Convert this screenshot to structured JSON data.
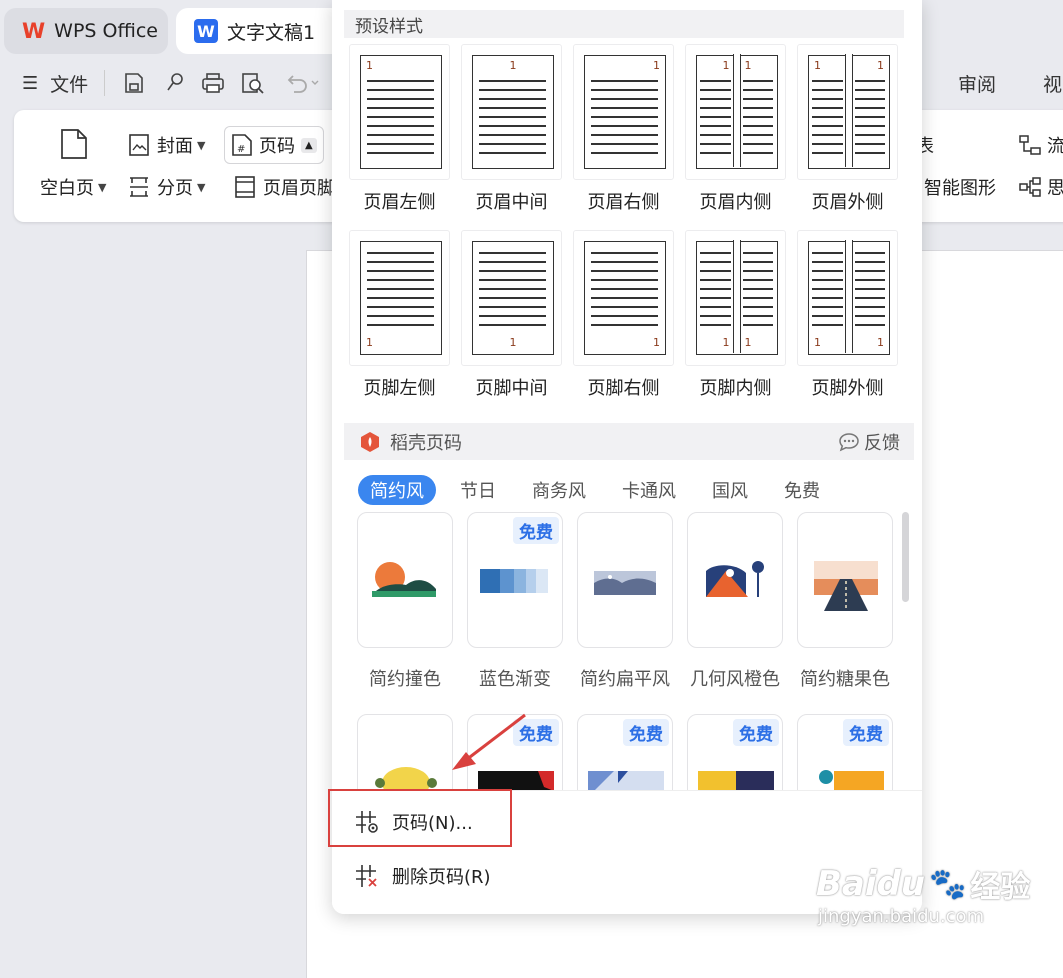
{
  "tabs": [
    {
      "label": "WPS Office",
      "icon": "wps-logo-icon"
    },
    {
      "label": "文字文稿1",
      "icon": "writer-doc-icon"
    }
  ],
  "menu": {
    "file_label": "文件",
    "review_tab": "审阅",
    "view_tab_partial": "视"
  },
  "ribbon": {
    "blank_page": "空白页",
    "cover": "封面",
    "page_break": "分页",
    "page_number": "页码",
    "header_footer": "页眉页脚",
    "chart": "图表",
    "smart_shape": "智能图形",
    "flowchart_partial": "流",
    "mindmap_partial": "思"
  },
  "dropdown": {
    "preset_title": "预设样式",
    "header_presets": [
      {
        "label": "页眉左侧"
      },
      {
        "label": "页眉中间"
      },
      {
        "label": "页眉右侧"
      },
      {
        "label": "页眉内侧"
      },
      {
        "label": "页眉外侧"
      }
    ],
    "footer_presets": [
      {
        "label": "页脚左侧"
      },
      {
        "label": "页脚中间"
      },
      {
        "label": "页脚右侧"
      },
      {
        "label": "页脚内侧"
      },
      {
        "label": "页脚外侧"
      }
    ],
    "page_num_sample": "1",
    "daoke_title": "稻壳页码",
    "feedback": "反馈",
    "categories": [
      "简约风",
      "节日",
      "商务风",
      "卡通风",
      "国风",
      "免费"
    ],
    "active_category": "简约风",
    "templates_row1": [
      {
        "label": "简约撞色",
        "free": false
      },
      {
        "label": "蓝色渐变",
        "free": true
      },
      {
        "label": "简约扁平风",
        "free": false
      },
      {
        "label": "几何风橙色",
        "free": false
      },
      {
        "label": "简约糖果色",
        "free": false
      }
    ],
    "templates_row2": [
      {
        "free": false
      },
      {
        "free": true
      },
      {
        "free": true
      },
      {
        "free": true
      },
      {
        "free": true
      }
    ],
    "free_badge": "免费",
    "menu_page_number": "页码(N)...",
    "menu_delete_page_number": "删除页码(R)"
  },
  "watermark": {
    "brand": "Baidu",
    "sub_brand": "经验",
    "url": "jingyan.baidu.com"
  },
  "colors": {
    "accent": "#3a86ef",
    "highlight_box": "#d9413e",
    "annotation_arrow": "#d9413e",
    "page_num": "#8a3a1b",
    "free_badge_text": "#2c6fe6"
  }
}
